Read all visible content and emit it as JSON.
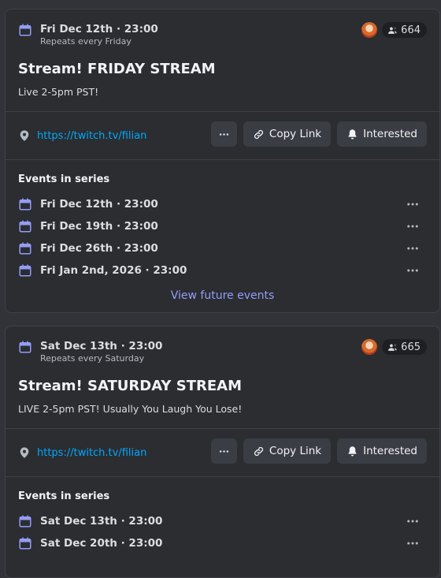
{
  "events": [
    {
      "date": "Fri Dec 12th · 23:00",
      "repeat": "Repeats every Friday",
      "interested_count": "664",
      "title": "Stream! FRIDAY STREAM",
      "description": "Live 2-5pm PST!",
      "location": "https://twitch.tv/filian",
      "copy_label": "Copy Link",
      "interested_label": "Interested",
      "series_title": "Events in series",
      "series": [
        "Fri Dec 12th · 23:00",
        "Fri Dec 19th · 23:00",
        "Fri Dec 26th · 23:00",
        "Fri Jan 2nd, 2026 · 23:00"
      ],
      "view_future": "View future events"
    },
    {
      "date": "Sat Dec 13th · 23:00",
      "repeat": "Repeats every Saturday",
      "interested_count": "665",
      "title": "Stream! SATURDAY STREAM",
      "description": "LIVE 2-5pm PST! Usually You Laugh You Lose!",
      "location": "https://twitch.tv/filian",
      "copy_label": "Copy Link",
      "interested_label": "Interested",
      "series_title": "Events in series",
      "series": [
        "Sat Dec 13th · 23:00",
        "Sat Dec 20th · 23:00"
      ]
    }
  ],
  "colors": {
    "accent": "#949cf7",
    "link": "#00a8fc",
    "card": "#2b2d31",
    "background": "#313338"
  },
  "icons": [
    "calendar-icon",
    "people-icon",
    "location-pin-icon",
    "more-icon",
    "link-icon",
    "bell-icon"
  ]
}
